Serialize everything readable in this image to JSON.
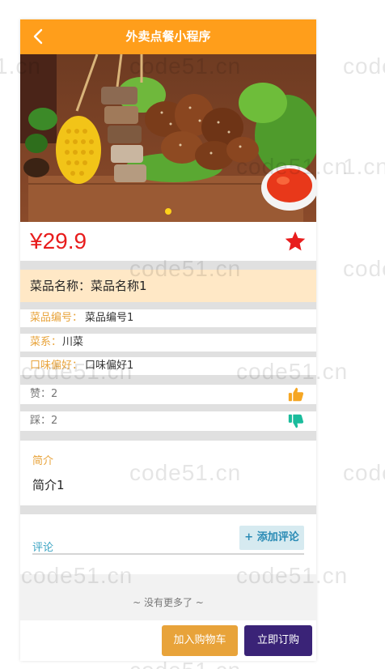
{
  "header": {
    "title": "外卖点餐小程序",
    "back_icon": "chevron-left-icon"
  },
  "banner": {
    "slides_total": 1,
    "active_slide": 1
  },
  "product": {
    "price": "¥29.9",
    "favorite_icon": "star-icon",
    "name_label": "菜品名称：",
    "name_value": "菜品名称1",
    "code_label": "菜品编号：",
    "code_value": "菜品编号1",
    "cuisine_label": "菜系：",
    "cuisine_value": "川菜",
    "taste_label": "口味偏好：",
    "taste_value": "口味偏好1",
    "likes_text": "赞：2",
    "dislikes_text": "踩：2",
    "like_icon": "thumbs-up-icon",
    "dislike_icon": "thumbs-down-icon"
  },
  "intro": {
    "title": "简介",
    "text": "简介1"
  },
  "comments": {
    "title": "评论",
    "add_label": "+ 添加评论",
    "empty_text": "~ 没有更多了 ~"
  },
  "actions": {
    "cart_label": "加入购物车",
    "buy_label": "立即订购"
  },
  "watermark": {
    "text": "code51.cn",
    "partial_text": "1.cn"
  },
  "colors": {
    "header": "#ff9e1b",
    "price": "#e81d1d",
    "label_orange": "#e8a33a",
    "name_row_bg": "#ffe8c6",
    "comment_blue": "#3aa3c2",
    "buy_button": "#3a2377",
    "like_icon": "#f5a623",
    "dislike_icon": "#1abc9c"
  }
}
